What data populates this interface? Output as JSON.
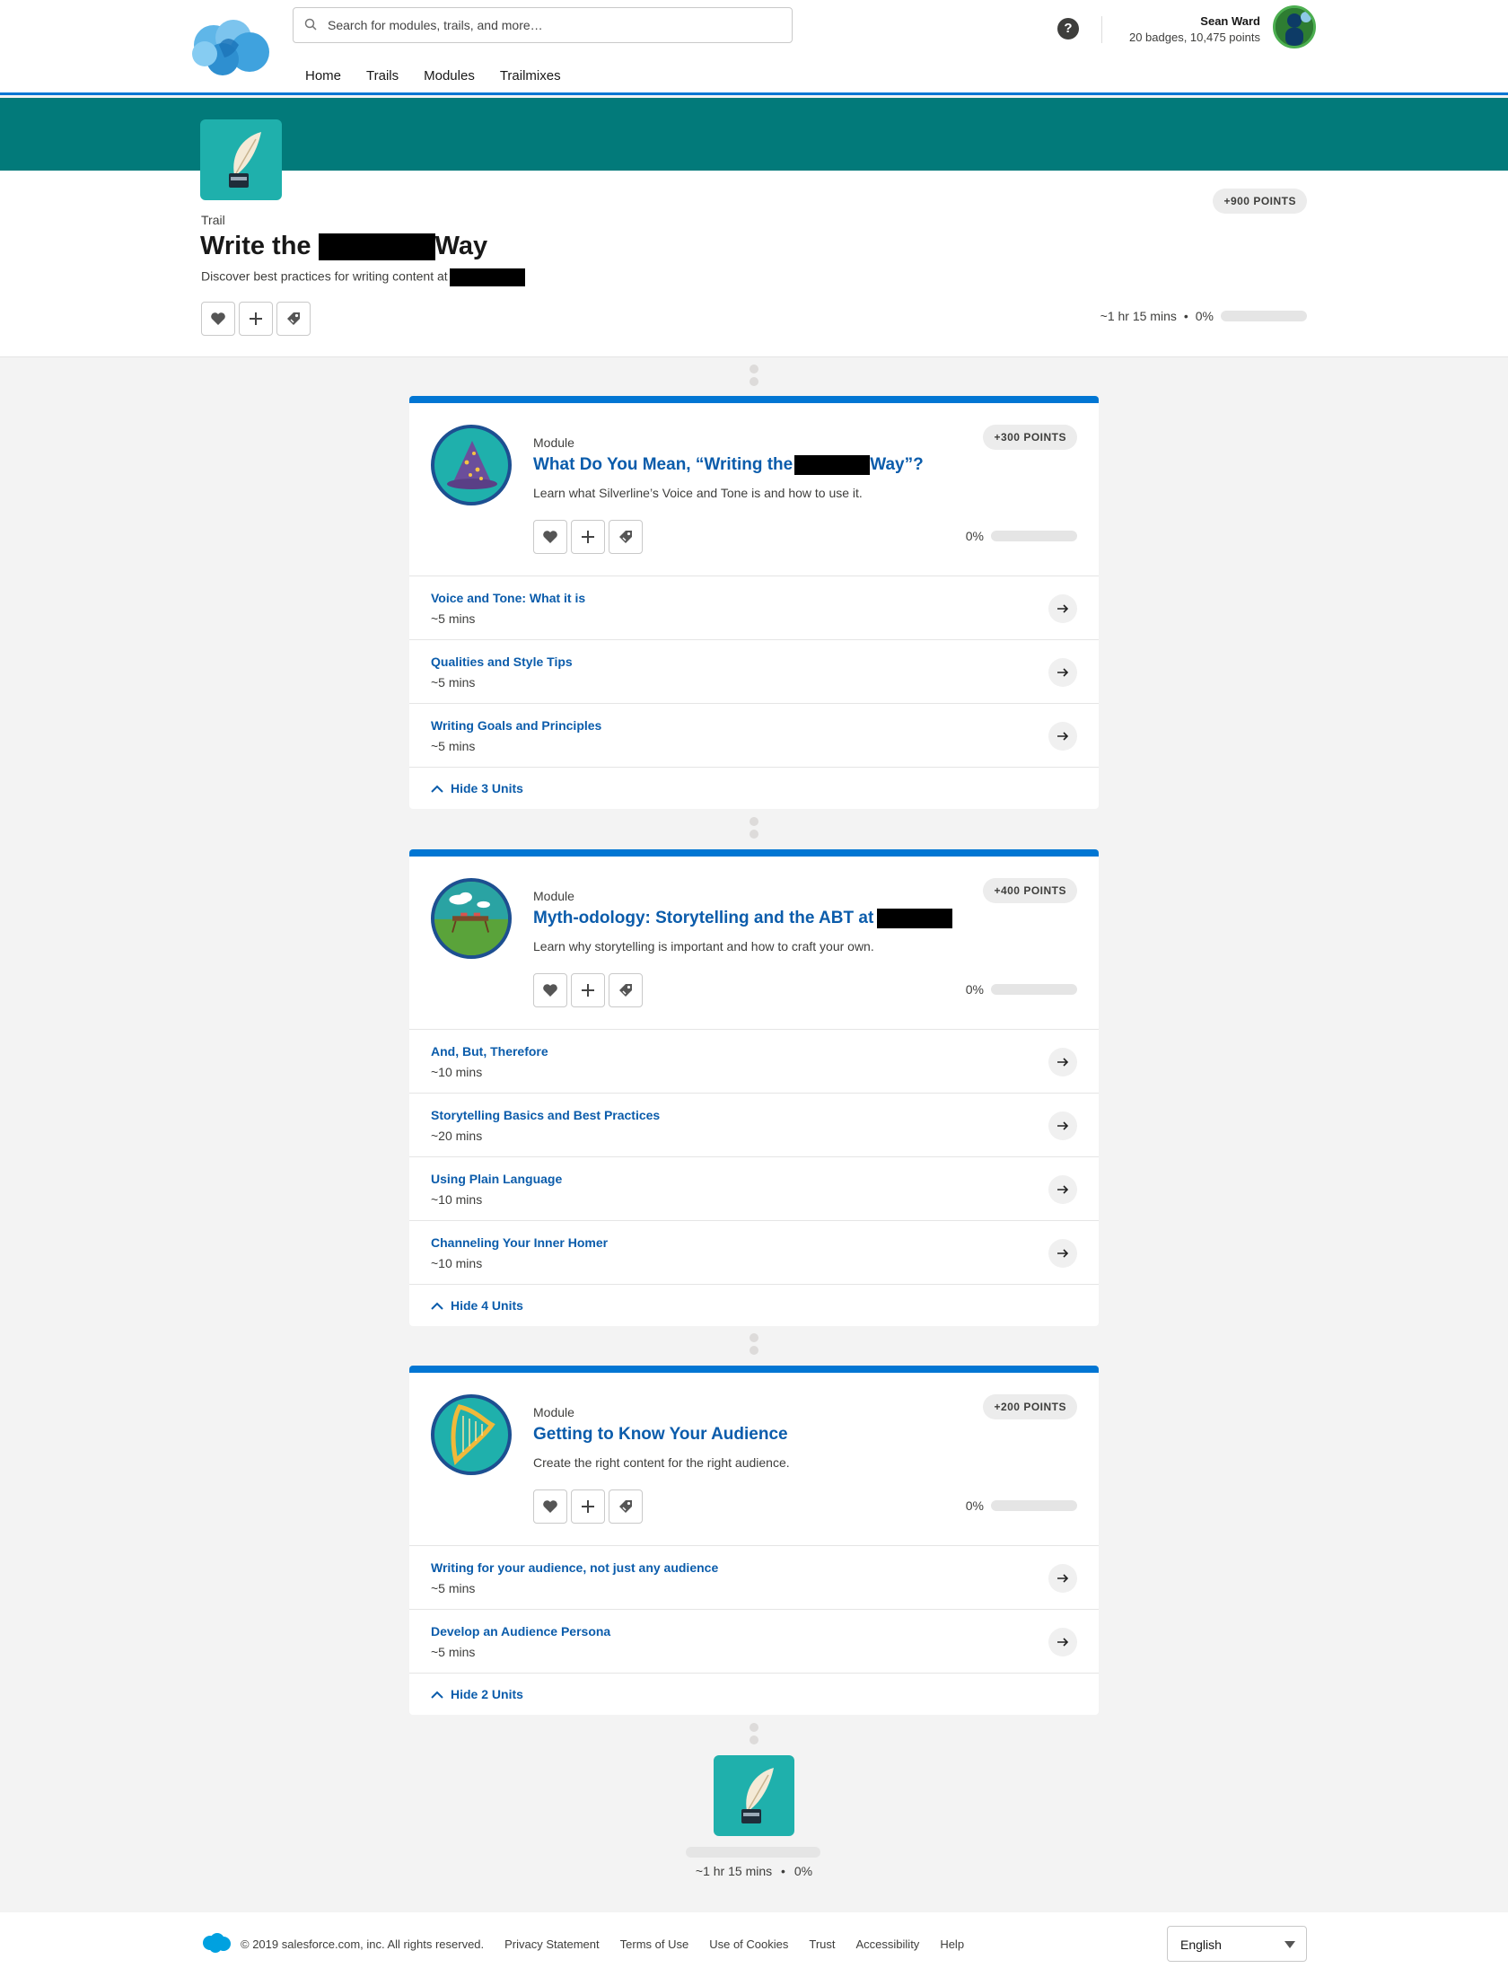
{
  "header": {
    "search_placeholder": "Search for modules, trails, and more…",
    "nav": [
      "Home",
      "Trails",
      "Modules",
      "Trailmixes"
    ],
    "help_label": "?",
    "user_name": "Sean Ward",
    "user_stats": "20 badges, 10,475 points"
  },
  "trail": {
    "kind": "Trail",
    "title_before": "Write the",
    "title_after": "Way",
    "description": "Discover best practices for writing content at",
    "points": "+900 POINTS",
    "duration": "~1 hr 15 mins",
    "separator": "•",
    "percent": "0%",
    "progress": 0
  },
  "modules": [
    {
      "kind": "Module",
      "title_before": "What Do You Mean, “Writing the",
      "title_after": "Way”?",
      "description": "Learn what Silverline’s Voice and Tone is and how to use it.",
      "points": "+300 POINTS",
      "percent": "0%",
      "progress": 0,
      "badge": "wizard-hat",
      "units": [
        {
          "title": "Voice and Tone: What it is",
          "time": "~5 mins"
        },
        {
          "title": "Qualities and Style Tips",
          "time": "~5 mins"
        },
        {
          "title": "Writing Goals and Principles",
          "time": "~5 mins"
        }
      ],
      "hide_label": "Hide 3 Units"
    },
    {
      "kind": "Module",
      "title_before": "Myth-odology: Storytelling and the ABT at",
      "title_after": "",
      "description": "Learn why storytelling is important and how to craft your own.",
      "points": "+400 POINTS",
      "percent": "0%",
      "progress": 0,
      "badge": "picnic-scene",
      "units": [
        {
          "title": "And, But, Therefore",
          "time": "~10 mins"
        },
        {
          "title": "Storytelling Basics and Best Practices",
          "time": "~20 mins"
        },
        {
          "title": "Using Plain Language",
          "time": "~10 mins"
        },
        {
          "title": "Channeling Your Inner Homer",
          "time": "~10 mins"
        }
      ],
      "hide_label": "Hide 4 Units"
    },
    {
      "kind": "Module",
      "title_before": "Getting to Know Your Audience",
      "title_after": "",
      "description": "Create the right content for the right audience.",
      "points": "+200 POINTS",
      "percent": "0%",
      "progress": 0,
      "badge": "harp",
      "units": [
        {
          "title": "Writing for your audience, not just any audience",
          "time": "~5 mins"
        },
        {
          "title": "Develop an Audience Persona",
          "time": "~5 mins"
        }
      ],
      "hide_label": "Hide 2 Units"
    }
  ],
  "summary": {
    "duration": "~1 hr 15 mins",
    "separator": "•",
    "percent": "0%",
    "progress": 0
  },
  "footer": {
    "copyright": "© 2019 salesforce.com, inc. All rights reserved.",
    "links": [
      "Privacy Statement",
      "Terms of Use",
      "Use of Cookies",
      "Trust",
      "Accessibility",
      "Help"
    ],
    "language": "English"
  },
  "colors": {
    "accent_blue": "#0176d3",
    "link_blue": "#0b5cab",
    "hero_teal": "#027a7a",
    "icon_teal": "#1fb0ac"
  },
  "icons": [
    "search-icon",
    "help-icon",
    "heart-icon",
    "plus-icon",
    "tag-icon",
    "arrow-right-icon",
    "chevron-up-icon",
    "quill-icon",
    "salesforce-logo"
  ]
}
